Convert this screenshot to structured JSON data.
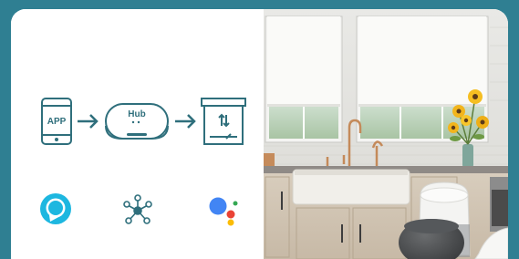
{
  "flow": {
    "app_label": "APP",
    "hub_label": "Hub"
  },
  "colors": {
    "icon_stroke": "#2f6f7c",
    "alexa": "#1db7e0",
    "smartthings": "#2f6f7c",
    "google_blue": "#4285f4",
    "google_red": "#ea4335",
    "google_yellow": "#fbbc05",
    "google_green": "#34a853",
    "background_teal": "#2f7f92"
  },
  "icons": [
    "phone-app-icon",
    "arrow-right-icon",
    "hub-icon",
    "arrow-right-icon",
    "blind-motor-icon",
    "alexa-icon",
    "smartthings-icon",
    "google-assistant-icon"
  ],
  "photo": {
    "subject": "kitchen-with-roller-blinds-and-smart-speakers"
  }
}
